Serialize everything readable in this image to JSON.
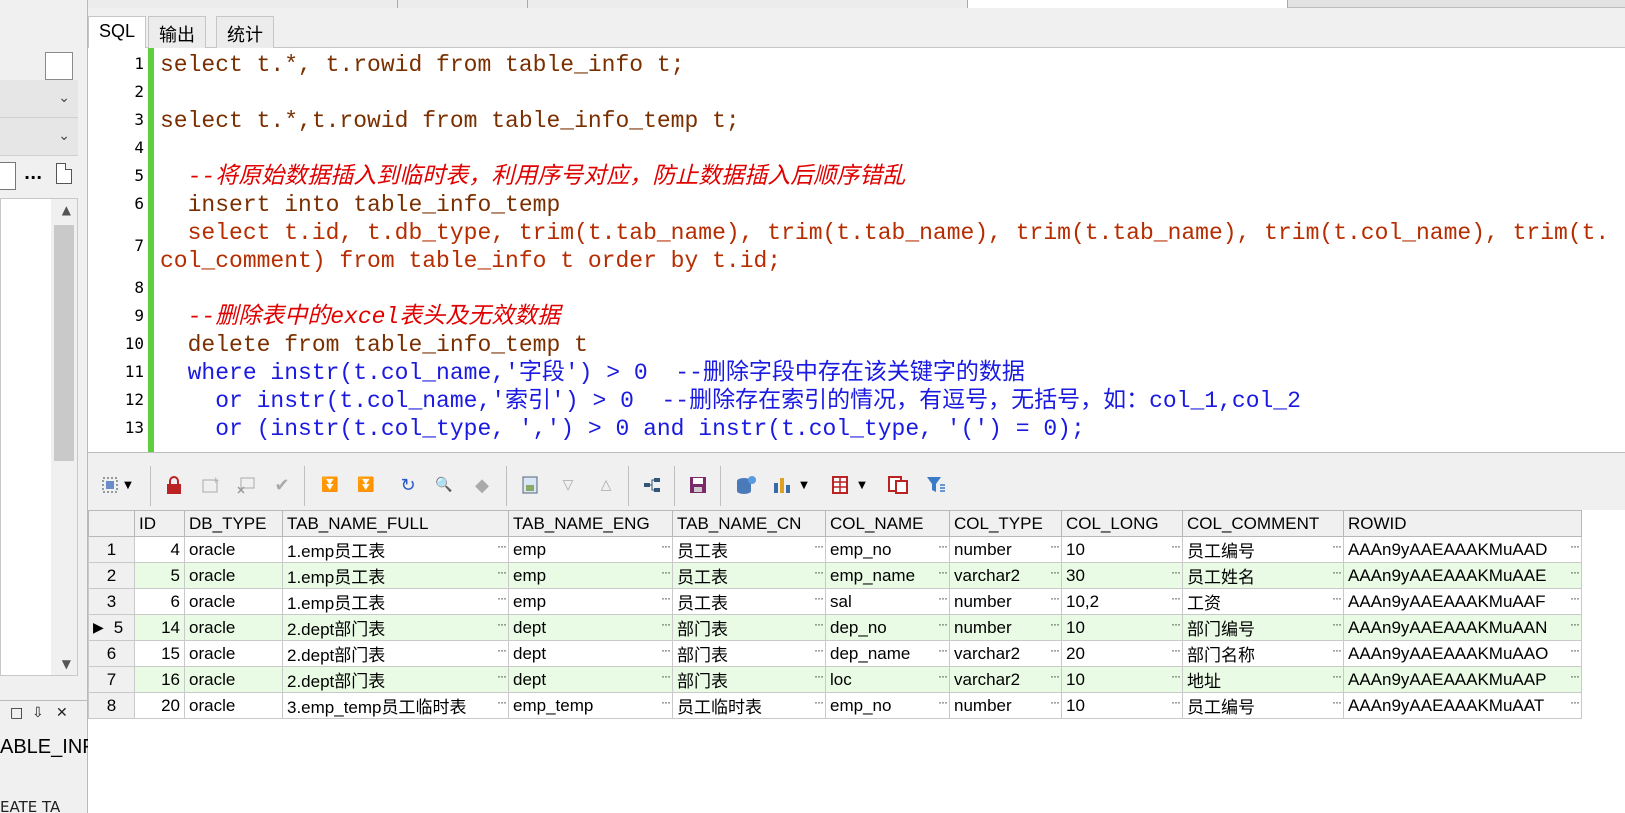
{
  "left_panel": {
    "dots_label": "...",
    "bottom_icons": [
      "□",
      "⇩",
      "✕"
    ],
    "table_label": "ABLE_INF",
    "bottom_text": "EATE TA"
  },
  "sql_tabs": [
    {
      "label": "SQL",
      "active": true
    },
    {
      "label": "输出",
      "active": false
    },
    {
      "label": "统计",
      "active": false
    }
  ],
  "editor": {
    "line_numbers": [
      "1",
      "2",
      "3",
      "4",
      "5",
      "6",
      "7",
      "8",
      "9",
      "10",
      "11",
      "12",
      "13"
    ],
    "lines": [
      "select t.*, t.rowid from table_info t;",
      "",
      "select t.*,t.rowid from table_info_temp t;",
      "",
      "  --将原始数据插入到临时表，利用序号对应，防止数据插入后顺序错乱",
      "  insert into table_info_temp",
      "  select t.id, t.db_type, trim(t.tab_name), trim(t.tab_name), trim(t.tab_name), trim(t.col_name), trim(t.",
      "col_comment) from table_info t order by t.id;",
      "",
      "  --删除表中的excel表头及无效数据",
      "  delete from table_info_temp t",
      "  where instr(t.col_name,'字段') > 0  --删除字段中存在该关键字的数据",
      "    or instr(t.col_name,'索引') > 0  --删除存在索引的情况，有逗号，无括号，如：col_1,col_2",
      "    or (instr(t.col_type, ',') > 0 and instr(t.col_type, '(') = 0);"
    ]
  },
  "toolbar": {
    "icons": [
      "select-mode-icon",
      "dropdown-icon",
      "lock-icon",
      "new-record-icon",
      "delete-record-icon",
      "post-icon",
      "first-icon",
      "last-icon",
      "refresh-icon",
      "find-icon",
      "clear-icon",
      "save-query-icon",
      "next-icon",
      "prev-icon",
      "tree-icon",
      "save-icon",
      "import-icon",
      "chart-icon",
      "dropdown-icon",
      "table-icon",
      "dropdown-icon",
      "export-icon",
      "filter-icon"
    ]
  },
  "grid": {
    "columns": [
      "ID",
      "DB_TYPE",
      "TAB_NAME_FULL",
      "TAB_NAME_ENG",
      "TAB_NAME_CN",
      "COL_NAME",
      "COL_TYPE",
      "COL_LONG",
      "COL_COMMENT",
      "ROWID"
    ],
    "rows": [
      {
        "rn": "1",
        "id": "4",
        "db_type": "oracle",
        "full": "1.emp员工表",
        "eng": "emp",
        "cn": "员工表",
        "col": "emp_no",
        "type": "number",
        "long": "10",
        "comment": "员工编号",
        "rowid": "AAAn9yAAEAAAKMuAAD",
        "current": false
      },
      {
        "rn": "2",
        "id": "5",
        "db_type": "oracle",
        "full": "1.emp员工表",
        "eng": "emp",
        "cn": "员工表",
        "col": "emp_name",
        "type": "varchar2",
        "long": "30",
        "comment": "员工姓名",
        "rowid": "AAAn9yAAEAAAKMuAAE",
        "current": false
      },
      {
        "rn": "3",
        "id": "6",
        "db_type": "oracle",
        "full": "1.emp员工表",
        "eng": "emp",
        "cn": "员工表",
        "col": "sal",
        "type": "number",
        "long": "10,2",
        "comment": "工资",
        "rowid": "AAAn9yAAEAAAKMuAAF",
        "current": false
      },
      {
        "rn": "5",
        "id": "14",
        "db_type": "oracle",
        "full": "2.dept部门表",
        "eng": "dept",
        "cn": "部门表",
        "col": "dep_no",
        "type": "number",
        "long": "10",
        "comment": "部门编号",
        "rowid": "AAAn9yAAEAAAKMuAAN",
        "current": true
      },
      {
        "rn": "6",
        "id": "15",
        "db_type": "oracle",
        "full": "2.dept部门表",
        "eng": "dept",
        "cn": "部门表",
        "col": "dep_name",
        "type": "varchar2",
        "long": "20",
        "comment": "部门名称",
        "rowid": "AAAn9yAAEAAAKMuAAO",
        "current": false
      },
      {
        "rn": "7",
        "id": "16",
        "db_type": "oracle",
        "full": "2.dept部门表",
        "eng": "dept",
        "cn": "部门表",
        "col": "loc",
        "type": "varchar2",
        "long": "10",
        "comment": "地址",
        "rowid": "AAAn9yAAEAAAKMuAAP",
        "current": false
      },
      {
        "rn": "8",
        "id": "20",
        "db_type": "oracle",
        "full": "3.emp_temp员工临时表",
        "eng": "emp_temp",
        "cn": "员工临时表",
        "col": "emp_no",
        "type": "number",
        "long": "10",
        "comment": "员工编号",
        "rowid": "AAAn9yAAEAAAKMuAAT",
        "current": false
      }
    ]
  },
  "colors": {
    "alt_row": "#e9fbe5",
    "keyword": "#7a2f00",
    "comment": "#e00000",
    "string": "#1a1ae0",
    "gutter_bar": "#5fcf3f"
  }
}
